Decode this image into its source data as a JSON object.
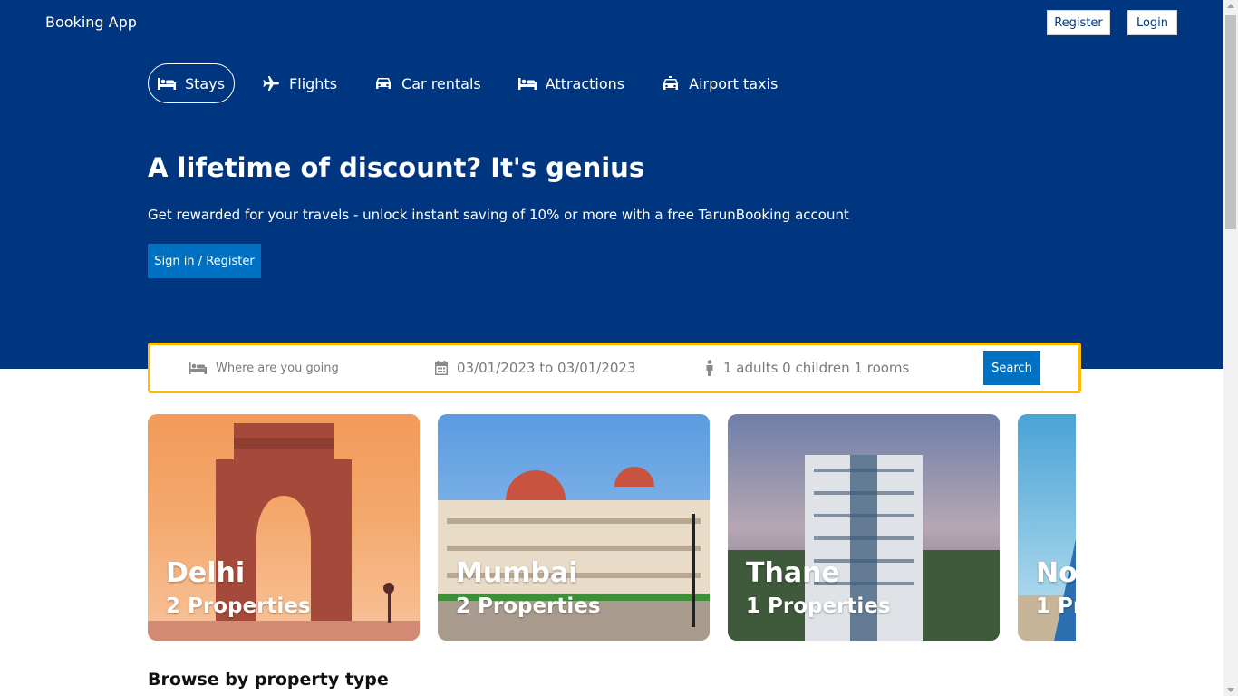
{
  "app": {
    "brand": "Booking App"
  },
  "nav": {
    "register_label": "Register",
    "login_label": "Login"
  },
  "tabs": [
    {
      "label": "Stays",
      "icon": "bed-icon",
      "active": true
    },
    {
      "label": "Flights",
      "icon": "plane-icon",
      "active": false
    },
    {
      "label": "Car rentals",
      "icon": "car-icon",
      "active": false
    },
    {
      "label": "Attractions",
      "icon": "bed-icon",
      "active": false
    },
    {
      "label": "Airport taxis",
      "icon": "taxi-icon",
      "active": false
    }
  ],
  "hero": {
    "headline": "A lifetime of discount? It's genius",
    "subline": "Get rewarded for your travels - unlock instant saving of 10% or more with a free TarunBooking account",
    "signin_label": "Sign in / Register"
  },
  "search": {
    "destination_placeholder": "Where are you going",
    "dates": "03/01/2023 to 03/01/2023",
    "options": "1 adults 0 children 1 rooms",
    "button_label": "Search"
  },
  "cities": [
    {
      "name": "Delhi",
      "properties": "2 Properties"
    },
    {
      "name": "Mumbai",
      "properties": "2 Properties"
    },
    {
      "name": "Thane",
      "properties": "1 Properties"
    },
    {
      "name": "No",
      "properties": "1 Pr"
    }
  ],
  "sections": {
    "browse_title": "Browse by property type"
  },
  "colors": {
    "header": "#003580",
    "button": "#0071c2",
    "search_border": "#febb02"
  }
}
